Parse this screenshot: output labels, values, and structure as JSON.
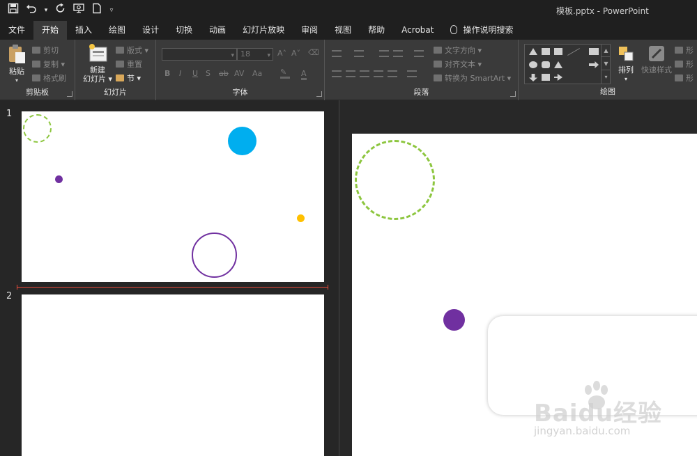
{
  "window": {
    "title": "模板.pptx  -  PowerPoint"
  },
  "quick_access": [
    {
      "name": "save",
      "glyph": "💾"
    },
    {
      "name": "undo",
      "glyph": "↶"
    },
    {
      "name": "undo-dropdown",
      "glyph": "▾"
    },
    {
      "name": "redo",
      "glyph": "↻"
    },
    {
      "name": "present",
      "glyph": "⎚"
    },
    {
      "name": "new",
      "glyph": "🗋"
    },
    {
      "name": "customize",
      "glyph": "▿"
    }
  ],
  "tabs": [
    "文件",
    "开始",
    "插入",
    "绘图",
    "设计",
    "切换",
    "动画",
    "幻灯片放映",
    "审阅",
    "视图",
    "帮助",
    "Acrobat",
    "操作说明搜索"
  ],
  "active_tab": "开始",
  "ribbon": {
    "clipboard": {
      "label": "剪贴板",
      "paste": "粘贴",
      "cut": "剪切",
      "copy": "复制",
      "format_painter": "格式刷"
    },
    "slides": {
      "label": "幻灯片",
      "new_slide_line1": "新建",
      "new_slide_line2": "幻灯片",
      "layout": "版式",
      "reset": "重置",
      "section": "节"
    },
    "font": {
      "label": "字体",
      "font_name": "",
      "font_size": "18",
      "format_buttons": [
        "B",
        "I",
        "U",
        "S",
        "ab",
        "AV",
        "Aa",
        "A"
      ]
    },
    "paragraph": {
      "label": "段落",
      "text_direction": "文字方向",
      "align_text": "对齐文本",
      "smartart": "转换为 SmartArt"
    },
    "drawing": {
      "label": "绘图",
      "arrange": "排列",
      "quick_styles": "快速样式",
      "shape_fill": "形",
      "shape_outline": "形",
      "shape_effects": "形"
    }
  },
  "slides": [
    {
      "number": "1"
    },
    {
      "number": "2"
    }
  ],
  "colors": {
    "green_dashed": "#8dc63f",
    "blue": "#00aeef",
    "purple": "#7030a0",
    "yellow": "#ffc000",
    "insert_line": "#e84a3a"
  },
  "watermark": {
    "main": "Baidu经验",
    "sub": "jingyan.baidu.com"
  }
}
